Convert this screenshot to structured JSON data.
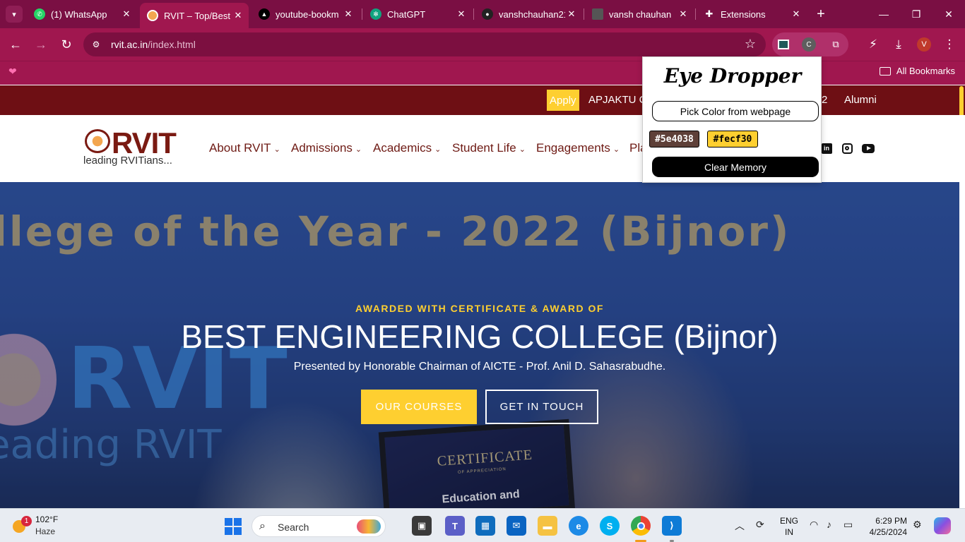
{
  "browser": {
    "tabs": [
      {
        "title": "(1) WhatsApp",
        "icon": "whatsapp-icon",
        "active": false
      },
      {
        "title": "RVIT – Top/Best",
        "icon": "rvit-favicon",
        "active": true
      },
      {
        "title": "youtube-bookm",
        "icon": "vercel-icon",
        "active": false
      },
      {
        "title": "ChatGPT",
        "icon": "chatgpt-icon",
        "active": false
      },
      {
        "title": "vanshchauhan21",
        "icon": "github-icon",
        "active": false
      },
      {
        "title": "vansh chauhan",
        "icon": "profile-photo-icon",
        "active": false
      },
      {
        "title": "Extensions",
        "icon": "puzzle-icon",
        "active": false
      }
    ],
    "omnibox": {
      "domain": "rvit.ac.in",
      "path": "/index.html"
    },
    "profile_initial": "V",
    "extension_label": "C",
    "bookmarks": {
      "all_label": "All Bookmarks"
    },
    "colors": {
      "frame": "#7a0f43",
      "toolbar": "#a0174f"
    }
  },
  "site": {
    "topbar": {
      "apply": "Apply",
      "links": [
        "APJAKTU C",
        "2",
        "Alumni"
      ]
    },
    "logo": {
      "name": "RVIT",
      "tagline": "leading RVITians..."
    },
    "menu": [
      {
        "label": "About RVIT"
      },
      {
        "label": "Admissions"
      },
      {
        "label": "Academics"
      },
      {
        "label": "Student Life"
      },
      {
        "label": "Engagements"
      },
      {
        "label": "Pla"
      }
    ],
    "social": [
      "linkedin-icon",
      "instagram-icon",
      "youtube-icon"
    ],
    "hero": {
      "banner_text": "llege of the Year  - 2022 (Bijnor)",
      "kicker": "AWARDED WITH CERTIFICATE & AWARD OF",
      "title": "BEST ENGINEERING COLLEGE (Bijnor)",
      "subtitle": "Presented by Honorable Chairman of AICTE - Prof. Anil D. Sahasrabudhe.",
      "btn_courses": "OUR COURSES",
      "btn_contact": "GET IN TOUCH",
      "bg_rvit": "RVIT",
      "bg_leading": "eading RVIT",
      "certificate_title": "CERTIFICATE",
      "certificate_sub": "OF APPRECIATION",
      "certificate_award": "Education and"
    },
    "colors": {
      "accent": "#fecf30",
      "maroon": "#6e0f14"
    }
  },
  "eye_dropper": {
    "title": "Eye Dropper",
    "pick_button": "Pick Color from webpage",
    "swatches": [
      {
        "hex": "#5e4038",
        "label": "#5e4038",
        "text_color": "#ffffff"
      },
      {
        "hex": "#fecf30",
        "label": "#fecf30",
        "text_color": "#000000"
      }
    ],
    "clear_button": "Clear Memory"
  },
  "taskbar": {
    "weather": {
      "temp": "102°F",
      "condition": "Haze",
      "badge": "1"
    },
    "search_placeholder": "Search",
    "language": {
      "line1": "ENG",
      "line2": "IN"
    },
    "clock": {
      "time": "6:29 PM",
      "date": "4/25/2024"
    }
  }
}
